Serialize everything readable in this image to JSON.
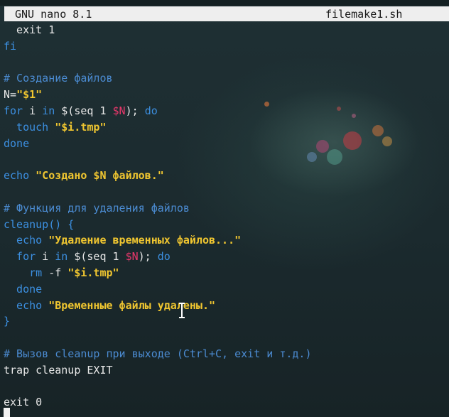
{
  "nano": {
    "app_version": "GNU nano 8.1",
    "filename": "filemake1.sh"
  },
  "code_lines": [
    [
      {
        "t": "  exit 1",
        "c": "plain"
      }
    ],
    [
      {
        "t": "fi",
        "c": "keyword"
      }
    ],
    [],
    [
      {
        "t": "# Создание файлов",
        "c": "comment"
      }
    ],
    [
      {
        "t": "N=",
        "c": "plain"
      },
      {
        "t": "\"$1\"",
        "c": "string"
      }
    ],
    [
      {
        "t": "for",
        "c": "keyword"
      },
      {
        "t": " i ",
        "c": "plain"
      },
      {
        "t": "in",
        "c": "keyword"
      },
      {
        "t": " $(seq 1 ",
        "c": "plain"
      },
      {
        "t": "$N",
        "c": "variable"
      },
      {
        "t": "); ",
        "c": "plain"
      },
      {
        "t": "do",
        "c": "keyword"
      }
    ],
    [
      {
        "t": "  touch ",
        "c": "keyword"
      },
      {
        "t": "\"$i.tmp\"",
        "c": "string"
      }
    ],
    [
      {
        "t": "done",
        "c": "keyword"
      }
    ],
    [],
    [
      {
        "t": "echo ",
        "c": "keyword"
      },
      {
        "t": "\"Создано $N файлов.\"",
        "c": "string"
      }
    ],
    [],
    [
      {
        "t": "# Функция для удаления файлов",
        "c": "comment"
      }
    ],
    [
      {
        "t": "cleanup() {",
        "c": "keyword"
      }
    ],
    [
      {
        "t": "  echo ",
        "c": "keyword"
      },
      {
        "t": "\"Удаление временных файлов...\"",
        "c": "string"
      }
    ],
    [
      {
        "t": "  for",
        "c": "keyword"
      },
      {
        "t": " i ",
        "c": "plain"
      },
      {
        "t": "in",
        "c": "keyword"
      },
      {
        "t": " $(seq 1 ",
        "c": "plain"
      },
      {
        "t": "$N",
        "c": "variable"
      },
      {
        "t": "); ",
        "c": "plain"
      },
      {
        "t": "do",
        "c": "keyword"
      }
    ],
    [
      {
        "t": "    rm ",
        "c": "keyword"
      },
      {
        "t": "-f ",
        "c": "plain"
      },
      {
        "t": "\"$i.tmp\"",
        "c": "string"
      }
    ],
    [
      {
        "t": "  done",
        "c": "keyword"
      }
    ],
    [
      {
        "t": "  echo ",
        "c": "keyword"
      },
      {
        "t": "\"Временные файлы удалены.\"",
        "c": "string"
      }
    ],
    [
      {
        "t": "}",
        "c": "keyword"
      }
    ],
    [],
    [
      {
        "t": "# Вызов cleanup при выходе (Ctrl+C, exit и т.д.)",
        "c": "comment"
      }
    ],
    [
      {
        "t": "trap cleanup EXIT",
        "c": "plain"
      }
    ],
    [],
    [
      {
        "t": "exit 0",
        "c": "plain"
      }
    ]
  ]
}
